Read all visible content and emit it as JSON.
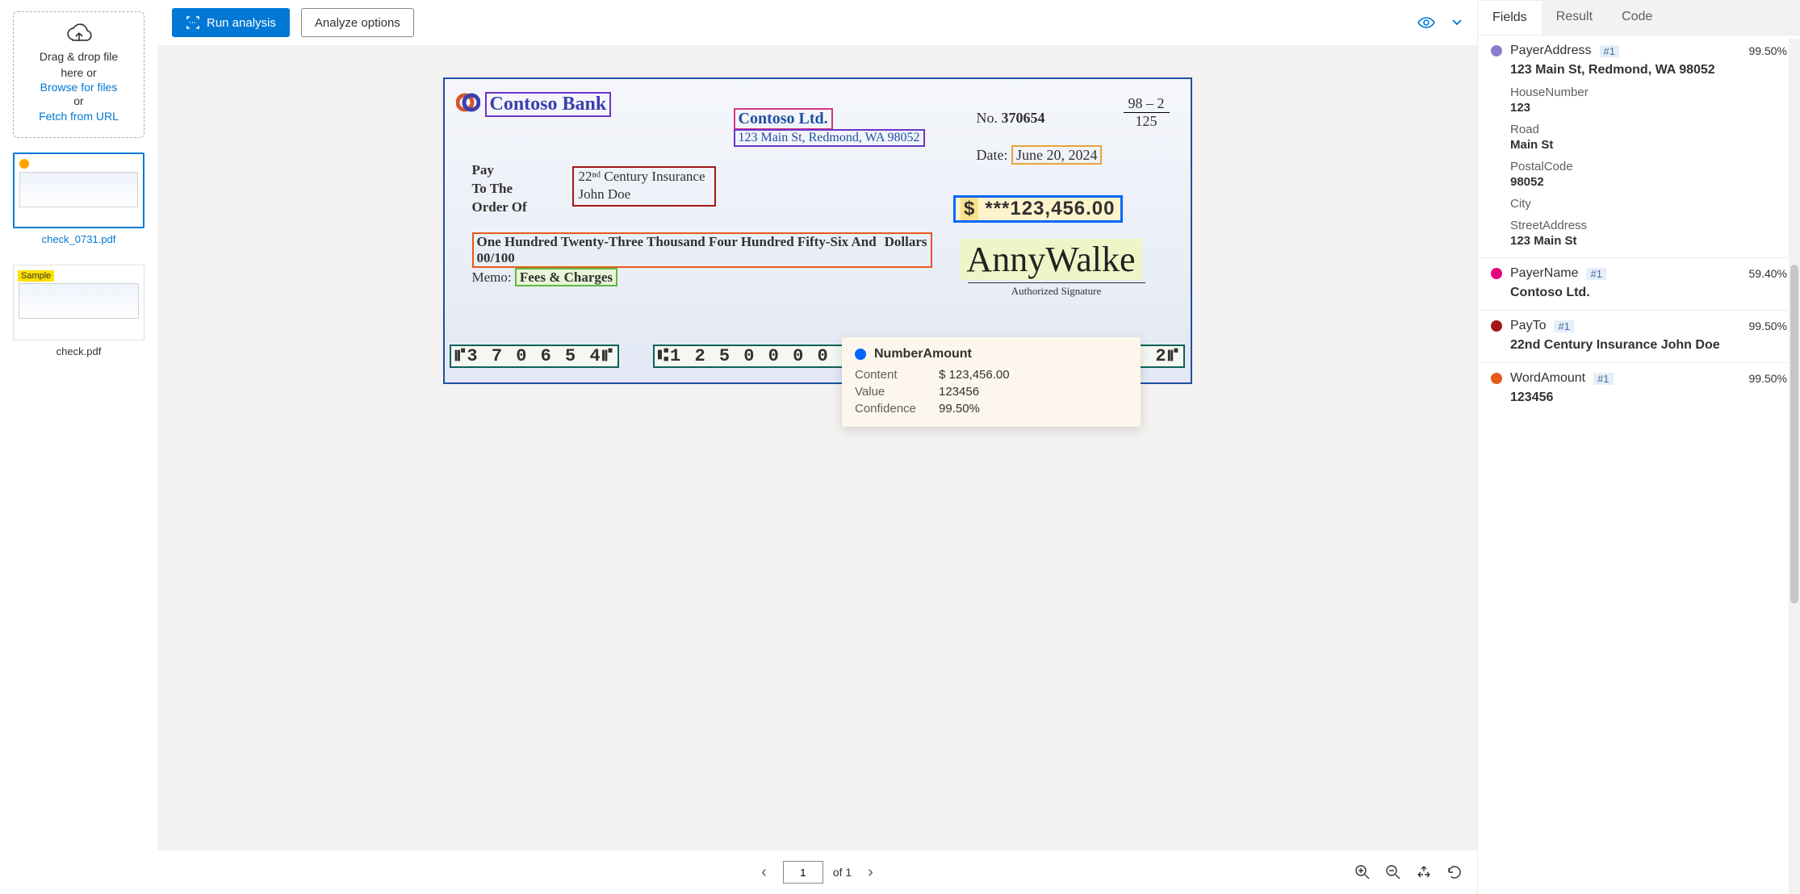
{
  "dropzone": {
    "line1": "Drag & drop file",
    "line2": "here or",
    "browse": "Browse for files",
    "or": "or",
    "fetch": "Fetch from URL"
  },
  "thumbs": [
    {
      "label": "check_0731.pdf",
      "selected": true,
      "dot": true
    },
    {
      "label": "check.pdf",
      "selected": false,
      "badge": "Sample"
    }
  ],
  "toolbar": {
    "run": "Run analysis",
    "options": "Analyze options"
  },
  "check": {
    "bank": "Contoso Bank",
    "payer": "Contoso Ltd.",
    "address": "123 Main St, Redmond, WA 98052",
    "numberLabel": "No.",
    "number": "370654",
    "fracTop": "98 – 2",
    "fracBot": "125",
    "dateLabel": "Date:",
    "date": "June 20, 2024",
    "paytoLabel1": "Pay",
    "paytoLabel2": "To The",
    "paytoLabel3": "Order Of",
    "payto1": "22ⁿᵈ Century Insurance",
    "payto2": "John Doe",
    "amountSym": "$",
    "amount": "***123,456.00",
    "words": "One Hundred Twenty-Three Thousand Four Hundred Fifty-Six And 00/100",
    "dollars": "Dollars",
    "memoLabel": "Memo:",
    "memo": "Fees & Charges",
    "signature": "AnnyWalke",
    "sigLabel": "Authorized Signature",
    "micr1": "⑈3 7 0 6 5 4⑈",
    "micr2": "⑆1 2 5 0 0 0 0 2 4⑆",
    "micr3": "8 4 9 5 0⑉5 5 4 3 2⑈"
  },
  "tooltip": {
    "title": "NumberAmount",
    "rows": [
      {
        "label": "Content",
        "value": "$ 123,456.00"
      },
      {
        "label": "Value",
        "value": "123456"
      },
      {
        "label": "Confidence",
        "value": "99.50%"
      }
    ]
  },
  "pager": {
    "page": "1",
    "of": "of 1"
  },
  "tabs": {
    "fields": "Fields",
    "result": "Result",
    "code": "Code"
  },
  "fields": [
    {
      "color": "#8d7bd0",
      "name": "PayerAddress",
      "tag": "#1",
      "conf": "99.50%",
      "value": "123 Main St, Redmond, WA 98052",
      "subs": [
        {
          "label": "HouseNumber",
          "value": "123"
        },
        {
          "label": "Road",
          "value": "Main St"
        },
        {
          "label": "PostalCode",
          "value": "98052"
        },
        {
          "label": "City",
          "value": ""
        },
        {
          "label": "StreetAddress",
          "value": "123 Main St"
        }
      ]
    },
    {
      "color": "#e5007d",
      "name": "PayerName",
      "tag": "#1",
      "conf": "59.40%",
      "value": "Contoso Ltd."
    },
    {
      "color": "#a01818",
      "name": "PayTo",
      "tag": "#1",
      "conf": "99.50%",
      "value": "22nd Century Insurance John Doe"
    },
    {
      "color": "#e8591c",
      "name": "WordAmount",
      "tag": "#1",
      "conf": "99.50%",
      "value": "123456"
    }
  ]
}
